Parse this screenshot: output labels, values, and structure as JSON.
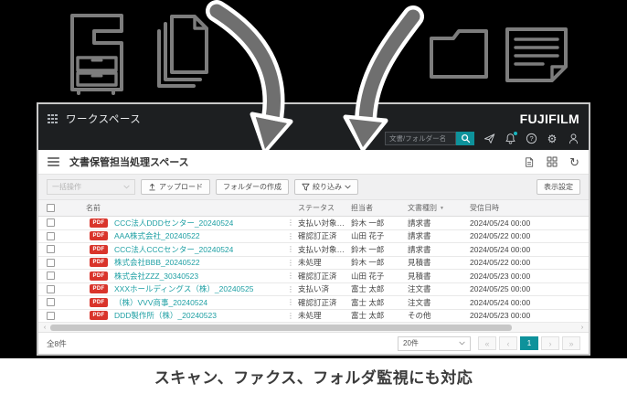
{
  "colors": {
    "accent": "#0E929B",
    "link": "#1FA0A4",
    "pdf_badge": "#D9342B",
    "notification_dot": "#19B5BE"
  },
  "hero": {
    "caption": "スキャン、ファクス、フォルダ監視にも対応",
    "icons": [
      "copier-icon",
      "documents-stack-icon",
      "folder-icon",
      "fax-document-icon"
    ]
  },
  "titlebar": {
    "title": "ワークスペース",
    "brand": "FUJIFILM",
    "search": {
      "placeholder": "文書/フォルダー名"
    }
  },
  "subheader": {
    "title": "文書保管担当処理スペース"
  },
  "toolbar": {
    "bulk_action": "一括操作",
    "upload": "アップロード",
    "create_folder": "フォルダーの作成",
    "filter": "絞り込み",
    "display_settings": "表示設定"
  },
  "table": {
    "columns": {
      "name": "名前",
      "status": "ステータス",
      "assignee": "担当者",
      "doc_type": "文書種別",
      "received": "受信日時"
    },
    "rows": [
      {
        "badge": "PDF",
        "name": "CCC法人DDDセンター_20240524",
        "status": "支払い対象…",
        "assignee": "鈴木 一郎",
        "doc_type": "請求書",
        "received": "2024/05/24 00:00"
      },
      {
        "badge": "PDF",
        "name": "AAA株式会社_20240522",
        "status": "確認訂正済",
        "assignee": "山田 花子",
        "doc_type": "請求書",
        "received": "2024/05/22 00:00"
      },
      {
        "badge": "PDF",
        "name": "CCC法人CCCセンター_20240524",
        "status": "支払い対象…",
        "assignee": "鈴木 一郎",
        "doc_type": "請求書",
        "received": "2024/05/24 00:00"
      },
      {
        "badge": "PDF",
        "name": "株式会社BBB_20240522",
        "status": "未処理",
        "assignee": "鈴木 一郎",
        "doc_type": "見積書",
        "received": "2024/05/22 00:00"
      },
      {
        "badge": "PDF",
        "name": "株式会社ZZZ_30340523",
        "status": "確認訂正済",
        "assignee": "山田 花子",
        "doc_type": "見積書",
        "received": "2024/05/23 00:00"
      },
      {
        "badge": "PDF",
        "name": "XXXホールディングス（株）_20240525",
        "status": "支払い済",
        "assignee": "富士 太郎",
        "doc_type": "注文書",
        "received": "2024/05/25 00:00"
      },
      {
        "badge": "PDF",
        "name": "（株）VVV商事_20240524",
        "status": "確認訂正済",
        "assignee": "富士 太郎",
        "doc_type": "注文書",
        "received": "2024/05/24 00:00"
      },
      {
        "badge": "PDF",
        "name": "DDD製作所（株）_20240523",
        "status": "未処理",
        "assignee": "富士 太郎",
        "doc_type": "その他",
        "received": "2024/05/23 00:00"
      }
    ]
  },
  "footer": {
    "total": "全8件",
    "page_size": "20件",
    "pagination": {
      "first": "«",
      "prev": "‹",
      "current": "1",
      "next": "›",
      "last": "»"
    }
  },
  "glyphs": {
    "gear": "⚙",
    "refresh": "↻",
    "kebab": "⋮",
    "sort": "▼"
  }
}
